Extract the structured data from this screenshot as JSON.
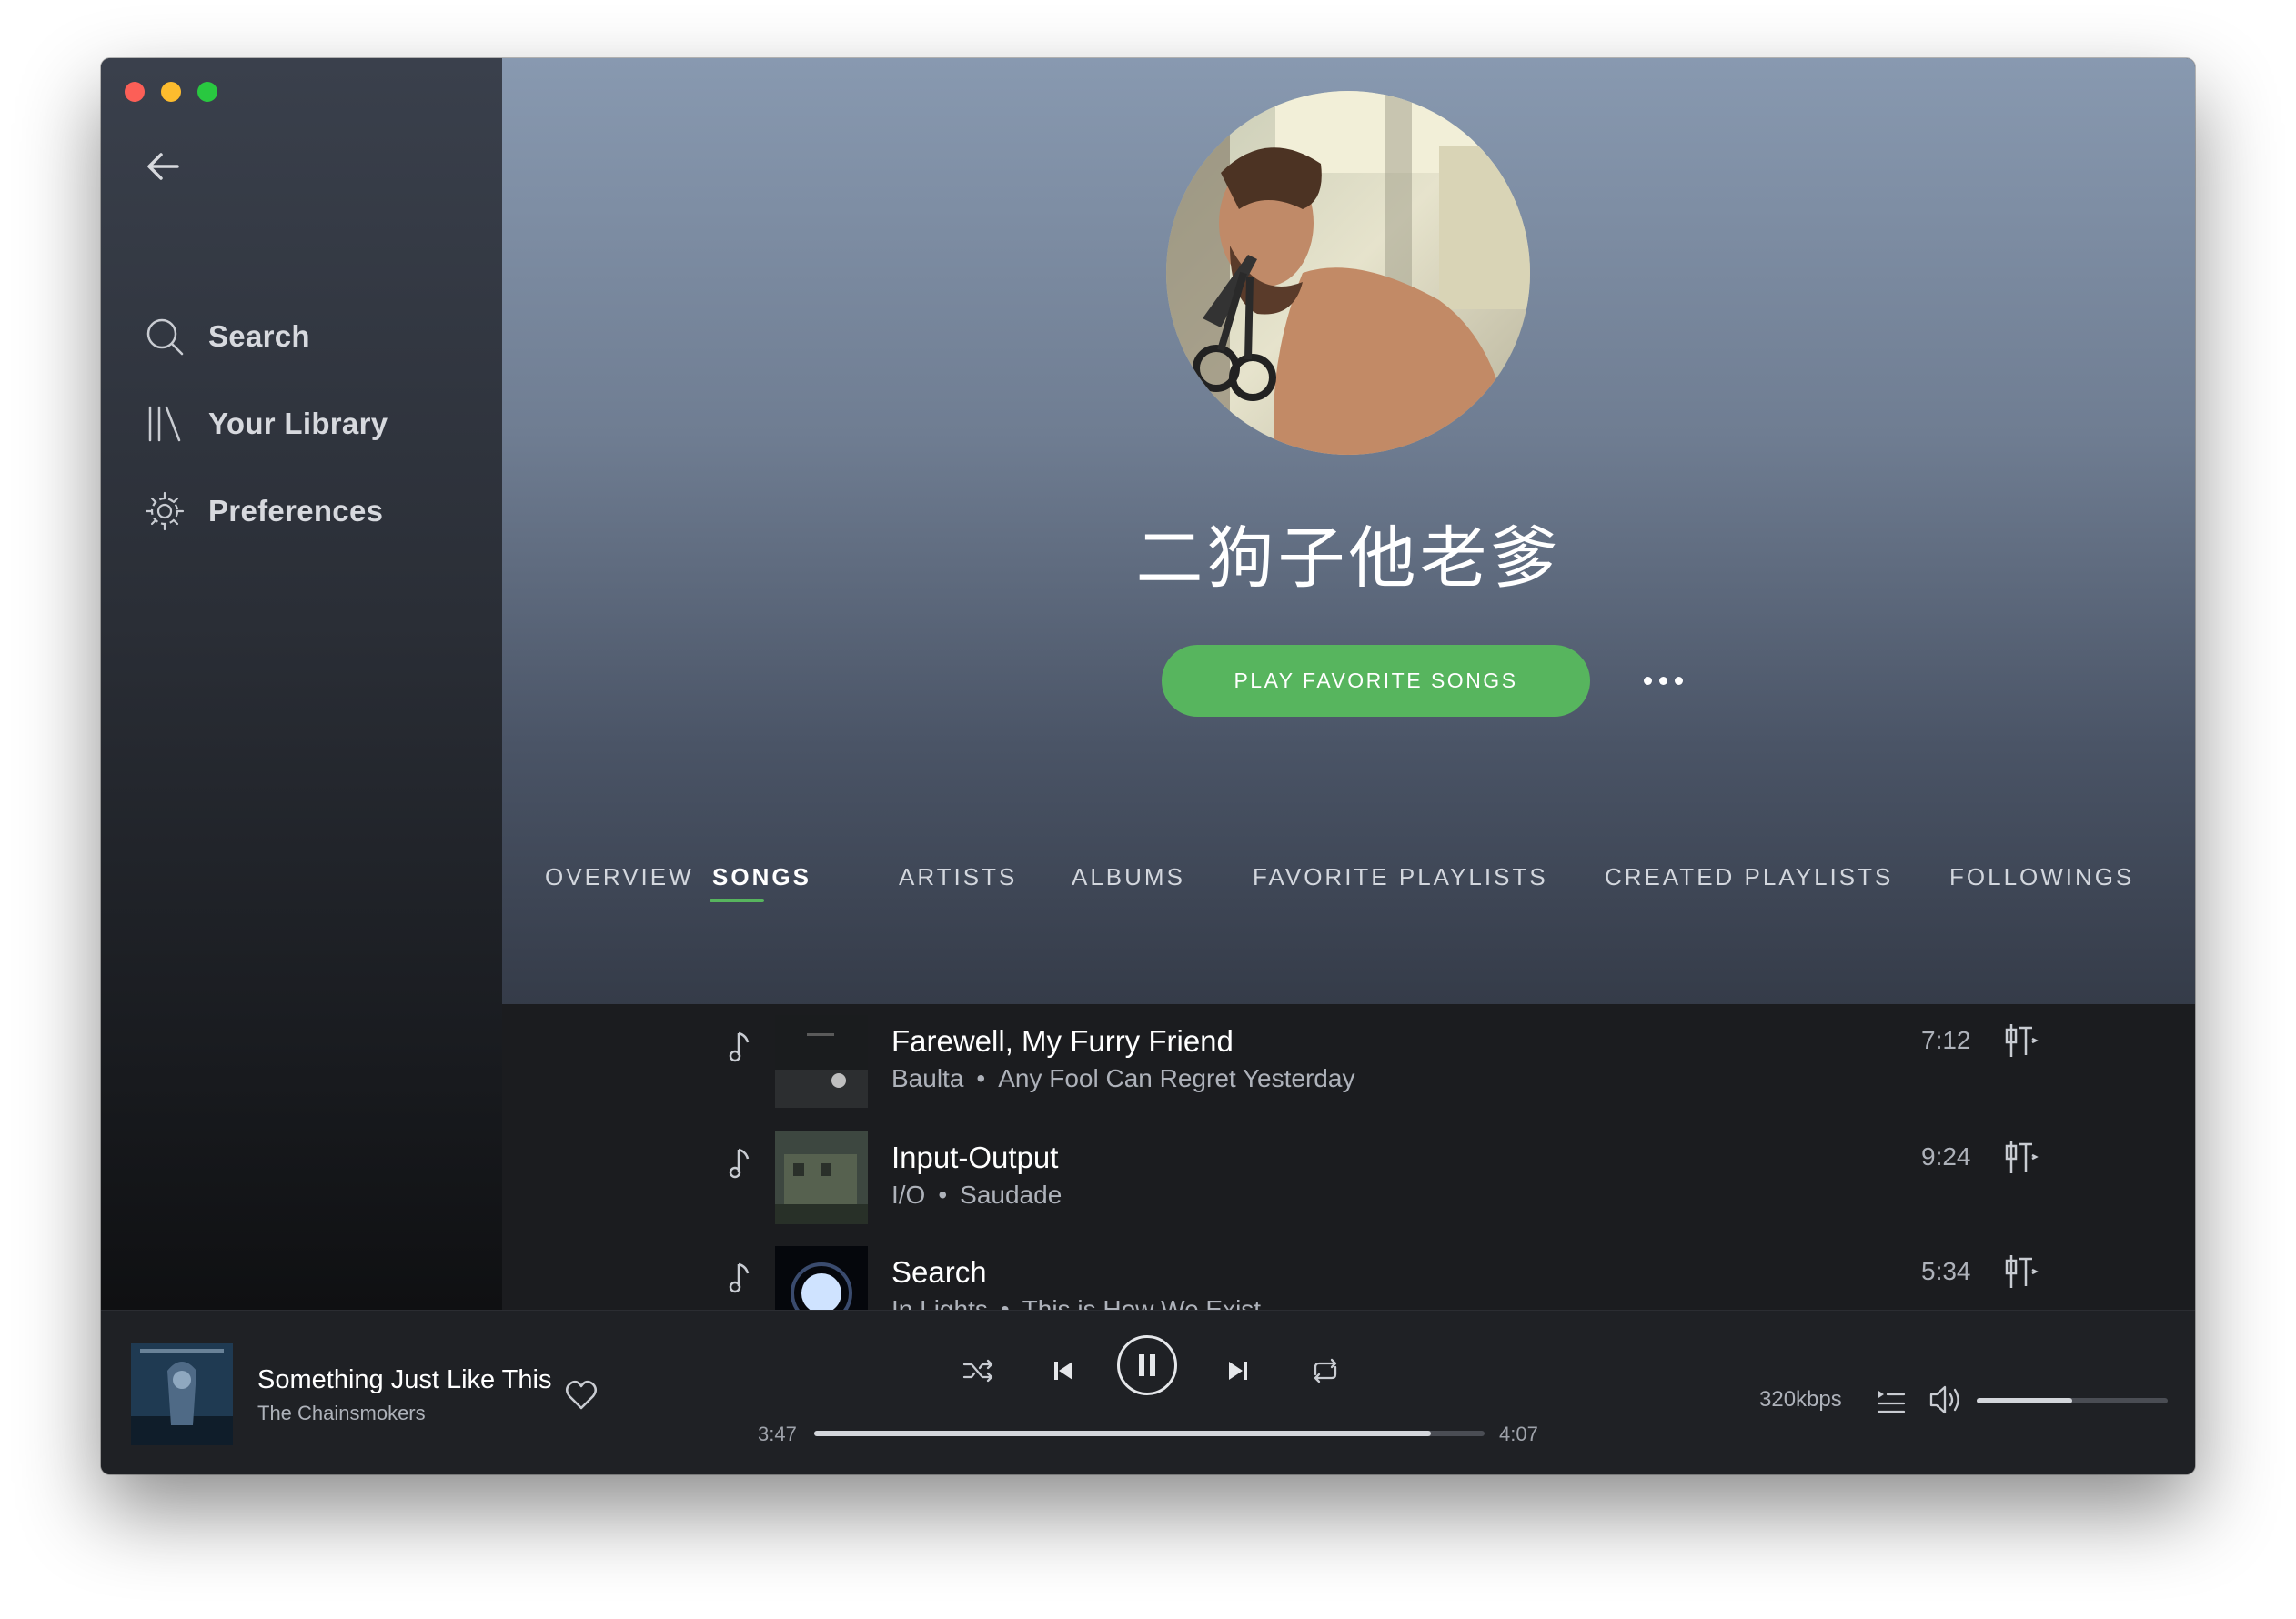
{
  "window": {
    "traffic_lights": [
      "close",
      "minimize",
      "zoom"
    ],
    "colors": {
      "close": "#fc5f57",
      "minimize": "#fdbc2e",
      "zoom": "#29c840",
      "accent": "#57b55e"
    }
  },
  "sidebar": {
    "back_icon": "arrow-left-icon",
    "items": [
      {
        "label": "Search",
        "icon": "search-icon"
      },
      {
        "label": "Your Library",
        "icon": "library-icon"
      },
      {
        "label": "Preferences",
        "icon": "gear-icon"
      }
    ]
  },
  "profile": {
    "username": "二狗子他老爹",
    "play_button": "PLAY FAVORITE SONGS",
    "more_icon": "ellipsis-icon"
  },
  "tabs": [
    {
      "label": "OVERVIEW",
      "active": false
    },
    {
      "label": "SONGS",
      "active": true
    },
    {
      "label": "ARTISTS",
      "active": false
    },
    {
      "label": "ALBUMS",
      "active": false
    },
    {
      "label": "FAVORITE PLAYLISTS",
      "active": false
    },
    {
      "label": "CREATED PLAYLISTS",
      "active": false
    },
    {
      "label": "FOLLOWINGS",
      "active": false
    }
  ],
  "songs": [
    {
      "title": "Farewell, My Furry Friend",
      "artist": "Baulta",
      "album": "Any Fool Can Regret Yesterday",
      "duration": "7:12"
    },
    {
      "title": "Input-Output",
      "artist": "I/O",
      "album": "Saudade",
      "duration": "9:24"
    },
    {
      "title": "Search",
      "artist": "In Lights",
      "album": "This is How We Exist",
      "duration": "5:34"
    }
  ],
  "player": {
    "title": "Something Just Like This",
    "artist": "The Chainsmokers",
    "current_time": "3:47",
    "total_time": "4:07",
    "progress": 0.92,
    "bitrate": "320kbps",
    "volume": 0.5,
    "controls": [
      "shuffle-icon",
      "previous-icon",
      "pause-icon",
      "next-icon",
      "repeat-icon"
    ]
  }
}
